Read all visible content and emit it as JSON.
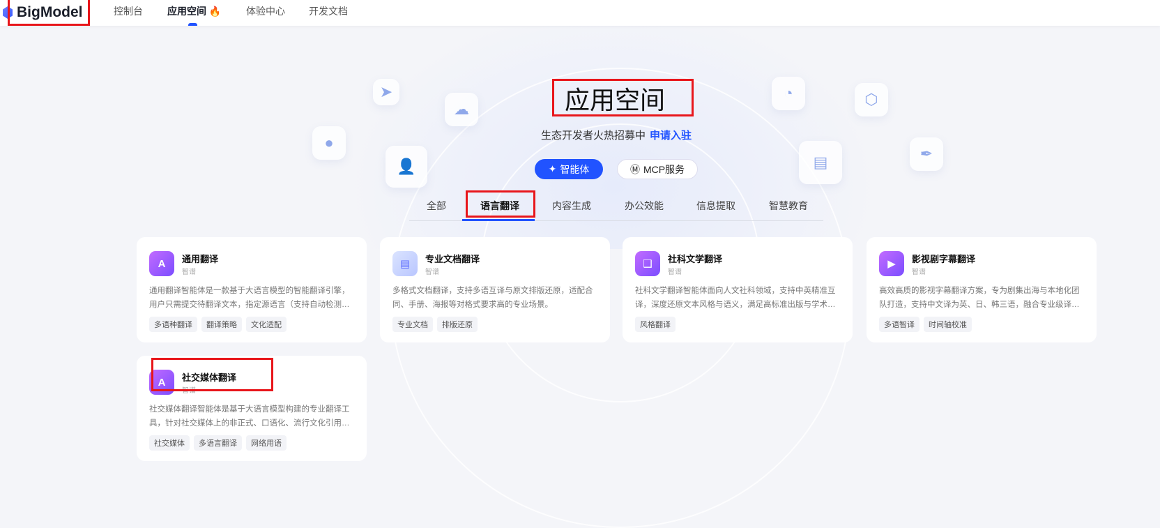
{
  "nav": {
    "logo": "BigModel",
    "items": [
      "控制台",
      "应用空间",
      "体验中心",
      "开发文档"
    ],
    "fire": "🔥"
  },
  "hero": {
    "title": "应用空间",
    "subtitle": "生态开发者火热招募中",
    "apply_link": "申请入驻",
    "buttons": [
      "智能体",
      "MCP服务"
    ]
  },
  "tabs": [
    "全部",
    "语言翻译",
    "内容生成",
    "办公效能",
    "信息提取",
    "智慧教育"
  ],
  "cards": [
    {
      "title": "通用翻译",
      "author": "智谱",
      "desc": "通用翻译智能体是一款基于大语言模型的智能翻译引擎，用户只需提交待翻译文本，指定源语言（支持自动检测）和目标语言即可",
      "tags": [
        "多语种翻译",
        "翻译策略",
        "文化适配"
      ]
    },
    {
      "title": "专业文档翻译",
      "author": "智谱",
      "desc": "多格式文档翻译，支持多语互译与原文排版还原，适配合同、手册、海报等对格式要求高的专业场景。",
      "tags": [
        "专业文档",
        "排版还原"
      ]
    },
    {
      "title": "社科文学翻译",
      "author": "智谱",
      "desc": "社科文学翻译智能体面向人文社科领域，支持中英精准互译，深度还原文本风格与语义，满足高标准出版与学术翻译需求",
      "tags": [
        "风格翻译"
      ]
    },
    {
      "title": "影视剧字幕翻译",
      "author": "智谱",
      "desc": "高效高质的影视字幕翻译方案，专为剧集出海与本地化团队打造，支持中文译为英、日、韩三语，融合专业级译文、时间轴校准",
      "tags": [
        "多语智译",
        "时间轴校准"
      ]
    },
    {
      "title": "社交媒体翻译",
      "author": "智谱",
      "desc": "社交媒体翻译智能体是基于大语言模型构建的专业翻译工具，针对社交媒体上的非正式、口语化、流行文化引用和网络用语",
      "tags": [
        "社交媒体",
        "多语言翻译",
        "网络用语"
      ]
    }
  ]
}
